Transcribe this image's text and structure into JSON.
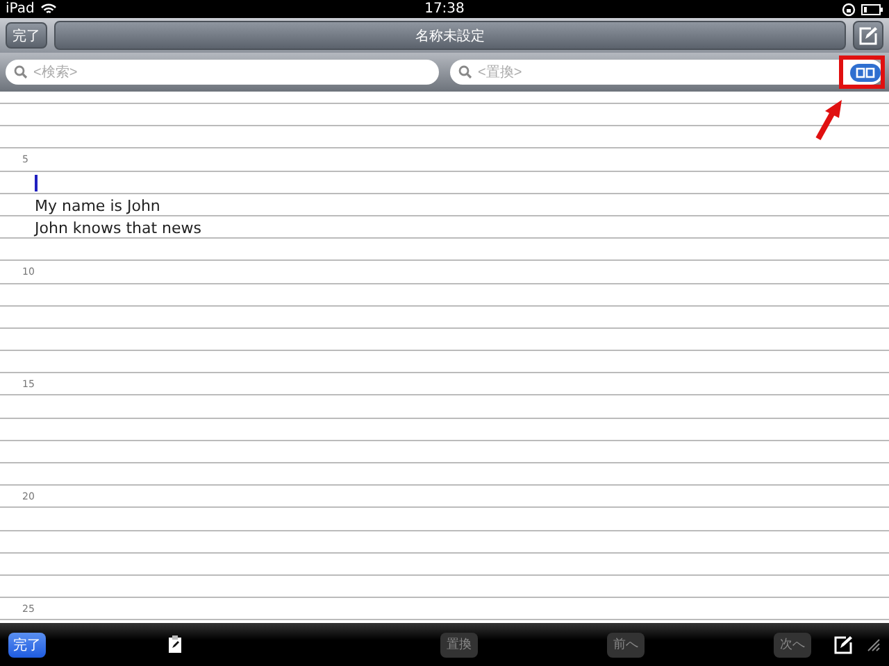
{
  "status_bar": {
    "device": "iPad",
    "time": "17:38"
  },
  "nav_bar": {
    "done_button": "完了",
    "title": "名称未設定"
  },
  "search_bar": {
    "search_placeholder": "<検索>",
    "replace_placeholder": "<置換>"
  },
  "lines": [
    {
      "cursor": false
    },
    {
      "cursor": false
    },
    {
      "number": "5",
      "cursor": false
    },
    {
      "cursor": true
    },
    {
      "text": "My name is John",
      "cursor": false
    },
    {
      "text": "John knows that news",
      "cursor": false
    },
    {
      "cursor": false
    },
    {
      "number": "10",
      "cursor": false
    },
    {
      "cursor": false
    },
    {
      "cursor": false
    },
    {
      "cursor": false
    },
    {
      "cursor": false
    },
    {
      "number": "15",
      "cursor": false
    },
    {
      "cursor": false
    },
    {
      "cursor": false
    },
    {
      "cursor": false
    },
    {
      "cursor": false
    },
    {
      "number": "20",
      "cursor": false
    },
    {
      "cursor": false
    },
    {
      "cursor": false
    },
    {
      "cursor": false
    },
    {
      "cursor": false
    },
    {
      "number": "25",
      "cursor": false
    }
  ],
  "toolbar": {
    "done_button": "完了",
    "replace_button": {
      "label": "置換",
      "disabled": true
    },
    "prev_button": {
      "label": "前へ",
      "disabled": true
    },
    "next_button": {
      "label": "次へ",
      "disabled": true
    }
  }
}
